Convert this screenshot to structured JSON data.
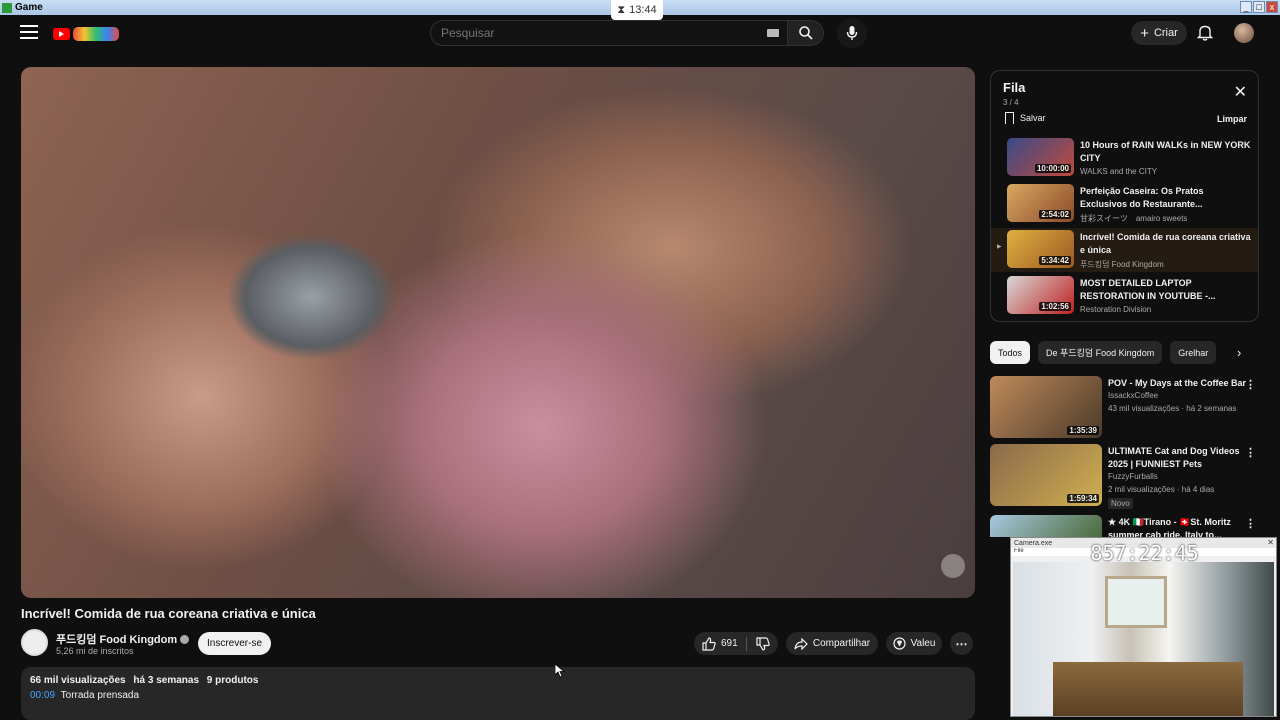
{
  "window": {
    "title": "Game",
    "controls": [
      "_",
      "□",
      "x"
    ]
  },
  "timer": {
    "time": "13:44",
    "icon": "hourglass-icon"
  },
  "header": {
    "search_placeholder": "Pesquisar",
    "create_label": "Criar",
    "icons": [
      "menu-icon",
      "youtube-logo",
      "keyboard-icon",
      "search-icon",
      "mic-icon",
      "plus-icon",
      "bell-icon",
      "avatar"
    ]
  },
  "video": {
    "title": "Incrível! Comida de rua coreana criativa e única",
    "channel": "푸드킹덤 Food Kingdom",
    "subscribers": "5,26 mi de inscritos",
    "subscribe_label": "Inscrever-se",
    "likes": "691",
    "share_label": "Compartilhar",
    "thanks_label": "Valeu",
    "description": {
      "views": "66 mil visualizações",
      "date": "há 3 semanas",
      "products": "9 produtos",
      "chapter_time": "00:09",
      "chapter_title": "Torrada prensada"
    }
  },
  "queue": {
    "title": "Fila",
    "count": "3 / 4",
    "save_label": "Salvar",
    "clear_label": "Limpar",
    "items": [
      {
        "title": "10 Hours of RAIN WALKs in NEW YORK CITY",
        "channel": "WALKS and the CITY",
        "duration": "10:00:00",
        "color1": "#3a4a8a",
        "color2": "#c04a3a",
        "active": false
      },
      {
        "title": "Perfeição Caseira: Os Pratos Exclusivos do Restaurante...",
        "channel": "甘彩スイーツ　amairo sweets",
        "duration": "2:54:02",
        "color1": "#d9a860",
        "color2": "#8a4a2a",
        "active": false
      },
      {
        "title": "Incrível! Comida de rua coreana criativa e única",
        "channel": "푸드킹덤 Food Kingdom",
        "duration": "5:34:42",
        "color1": "#e0b040",
        "color2": "#9a5a20",
        "active": true
      },
      {
        "title": "MOST DETAILED LAPTOP RESTORATION IN YOUTUBE -...",
        "channel": "Restoration Division",
        "duration": "1:02:56",
        "color1": "#d8d8d8",
        "color2": "#c02020",
        "active": false
      }
    ]
  },
  "chips": [
    "Todos",
    "De 푸드킹덤 Food Kingdom",
    "Grelhar"
  ],
  "recommendations": [
    {
      "title": "POV - My Days at the Coffee Bar",
      "channel": "IssackxCoffee",
      "views": "43 mil visualizações · há 2 semanas",
      "duration": "1:35:39",
      "badge": "",
      "color1": "#c08a5a",
      "color2": "#4a3a2a"
    },
    {
      "title": "ULTIMATE Cat and Dog Videos 2025 | FUNNIEST Pets",
      "channel": "FuzzyFurballs",
      "views": "2 mil visualizações · há 4 dias",
      "duration": "1:59:34",
      "badge": "Novo",
      "color1": "#8a6a4a",
      "color2": "#d0b050"
    },
    {
      "title": "★ 4K 🇮🇹Tirano - 🇨🇭St. Moritz summer cab ride, Italy to...",
      "channel": "",
      "views": "",
      "duration": "",
      "badge": "",
      "color1": "#a8c8e0",
      "color2": "#4a6a3a"
    }
  ],
  "overlay": {
    "title": "Camera.exe",
    "menu": "File",
    "clock": "857:22:45"
  }
}
